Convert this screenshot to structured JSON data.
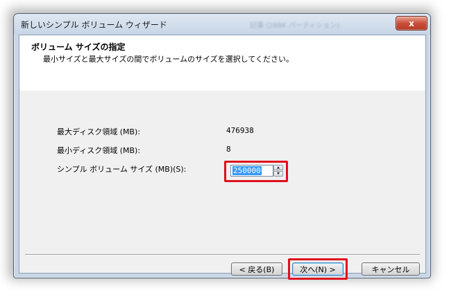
{
  "window": {
    "title": "新しいシンプル ボリューム ウィザード",
    "background_title": "記事 (288K パーティション)",
    "close_label": "x"
  },
  "header": {
    "title": "ボリューム サイズの指定",
    "subtitle": "最小サイズと最大サイズの間でボリュームのサイズを選択してください。"
  },
  "fields": {
    "max_label": "最大ディスク領域 (MB):",
    "max_value": "476938",
    "min_label": "最小ディスク領域 (MB):",
    "min_value": "8",
    "size_label": "シンプル ボリューム サイズ (MB)(S):",
    "size_value": "250000"
  },
  "buttons": {
    "back": "< 戻る(B)",
    "next": "次へ(N) >",
    "cancel": "キャンセル"
  },
  "colors": {
    "highlight": "#e0101c",
    "selection": "#3399ff"
  }
}
